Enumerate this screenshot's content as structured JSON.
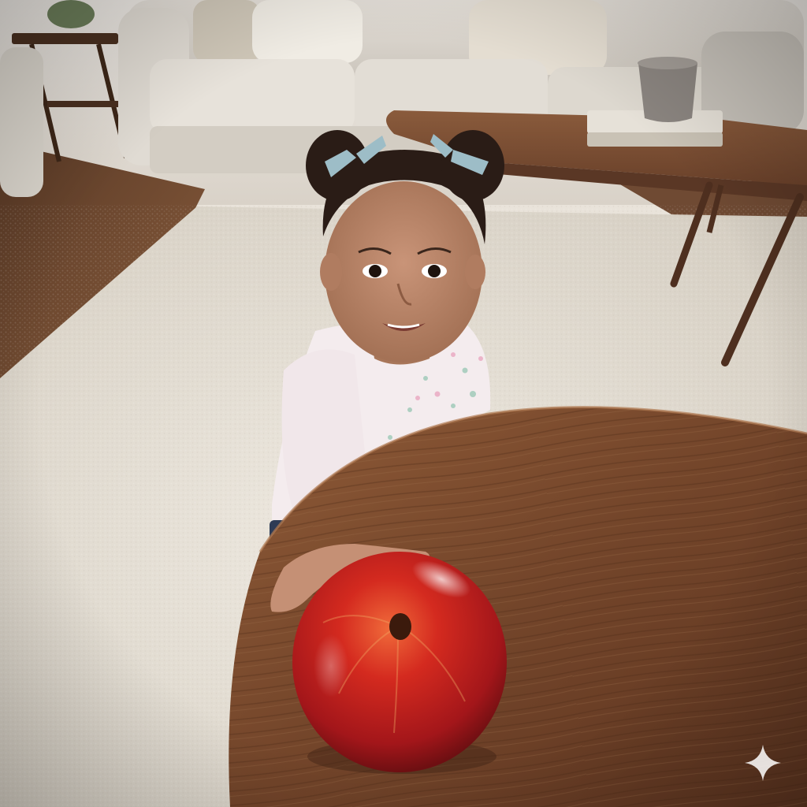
{
  "scene": {
    "palette": {
      "wall": "#e8e3dc",
      "floor_wood": "#6e4a32",
      "rug": "#e6e0d6",
      "sofa": "#dcd7cf",
      "table_wood": "#7a4a2e",
      "apple_red": "#c41d1d",
      "shirt": "#f4ecee",
      "skin": "#b98468",
      "hair": "#2a1c16",
      "hair_bow": "#9dbdc7",
      "mug": "#8b8580"
    },
    "icons": {
      "watermark": "sparkle-icon"
    }
  }
}
